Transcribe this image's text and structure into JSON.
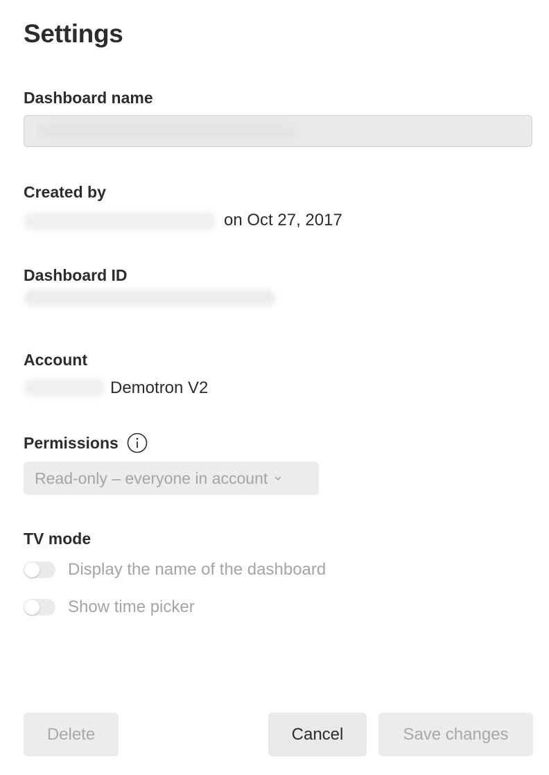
{
  "title": "Settings",
  "dashboard_name": {
    "label": "Dashboard name",
    "value": ""
  },
  "created_by": {
    "label": "Created by",
    "date_text": "on Oct 27, 2017"
  },
  "dashboard_id": {
    "label": "Dashboard ID"
  },
  "account": {
    "label": "Account",
    "name": "Demotron V2"
  },
  "permissions": {
    "label": "Permissions",
    "info_icon": "info-icon",
    "selected": "Read-only – everyone in account",
    "chevron_icon": "chevron-down-icon"
  },
  "tv_mode": {
    "label": "TV mode",
    "options": [
      {
        "label": "Display the name of the dashboard",
        "enabled": false
      },
      {
        "label": "Show time picker",
        "enabled": false
      }
    ]
  },
  "buttons": {
    "delete": "Delete",
    "cancel": "Cancel",
    "save": "Save changes"
  },
  "colors": {
    "text": "#2a2c2e",
    "muted": "#a2a5a8",
    "field_bg": "#e8e9ea"
  }
}
